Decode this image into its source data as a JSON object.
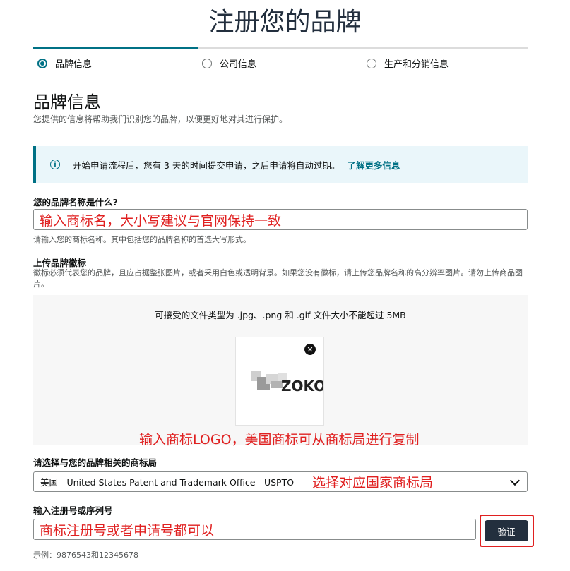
{
  "page": {
    "title": "注册您的品牌"
  },
  "steps": [
    {
      "label": "品牌信息",
      "active": true
    },
    {
      "label": "公司信息",
      "active": false
    },
    {
      "label": "生产和分销信息",
      "active": false
    }
  ],
  "section": {
    "title": "品牌信息",
    "subtitle": "您提供的信息将帮助我们识别您的品牌，以便更好地对其进行保护。"
  },
  "alert": {
    "text": "开始申请流程后，您有 3 天的时间提交申请，之后申请将自动过期。",
    "link": "了解更多信息"
  },
  "brand_name": {
    "label": "您的品牌名称是什么?",
    "value": "输入商标名，大小写建议与官网保持一致",
    "hint": "请输入您的商标名称。其中包括您的品牌名称的首选大写形式。"
  },
  "logo": {
    "label": "上传品牌徽标",
    "hint": "徽标必须代表您的品牌，且应占据整张图片，或者采用白色或透明背景。如果您没有徽标，请上传您品牌名称的高分辨率图片。请勿上传商品图片。",
    "file_types": "可接受的文件类型为 .jpg、.png 和 .gif    文件大小不能超过 5MB",
    "note": "输入商标LOGO，美国商标可从商标局进行复制",
    "logo_text": "ZOKO"
  },
  "trademark_office": {
    "label": "请选择与您的品牌相关的商标局",
    "selected": "美国 - United States Patent and Trademark Office - USPTO",
    "note": "选择对应国家商标局"
  },
  "registration": {
    "label": "输入注册号或序列号",
    "value": "商标注册号或者申请号都可以",
    "example": "示例：9876543和12345678",
    "verify_button": "验证"
  },
  "colors": {
    "accent": "#007185",
    "annotation": "#e02020",
    "button": "#232f3e"
  }
}
